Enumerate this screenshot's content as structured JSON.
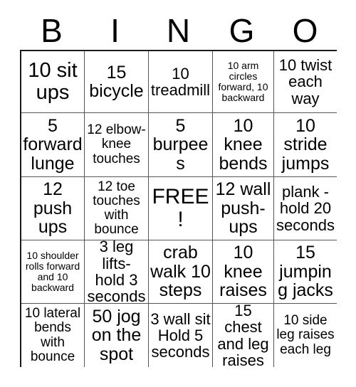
{
  "card": {
    "title": "BINGO",
    "header_letters": [
      "B",
      "I",
      "N",
      "G",
      "O"
    ],
    "free_space_label": "FREE!",
    "rows": 5,
    "columns": 5,
    "colors": {
      "background": "#ffffff",
      "text": "#000000",
      "grid_line": "#555555",
      "outer_border": "#1a1a1a"
    },
    "cells": [
      {
        "text": "10 sit ups",
        "size": "s-xl",
        "free": false
      },
      {
        "text": "15 bicycle",
        "size": "s-lg",
        "free": false
      },
      {
        "text": "10 treadmill",
        "size": "s-md",
        "free": false
      },
      {
        "text": "10 arm circles forward, 10 backward",
        "size": "s-xs",
        "free": false
      },
      {
        "text": "10 twist each way",
        "size": "s-md",
        "free": false
      },
      {
        "text": "5 forward lunge",
        "size": "s-lg",
        "free": false
      },
      {
        "text": "12 elbow-knee touches",
        "size": "s-sm",
        "free": false
      },
      {
        "text": "5 burpees",
        "size": "s-lg",
        "free": false
      },
      {
        "text": "10 knee bends",
        "size": "s-lg",
        "free": false
      },
      {
        "text": "10 stride jumps",
        "size": "s-lg",
        "free": false
      },
      {
        "text": "12 push ups",
        "size": "s-lg",
        "free": false
      },
      {
        "text": "12 toe touches with bounce",
        "size": "s-sm",
        "free": false
      },
      {
        "text": "FREE!",
        "size": "s-free",
        "free": true
      },
      {
        "text": "12 wall push-ups",
        "size": "s-lg",
        "free": false
      },
      {
        "text": "plank - hold 20 seconds",
        "size": "s-md",
        "free": false
      },
      {
        "text": "10 shoulder rolls forward and 10 backward",
        "size": "s-xs",
        "free": false
      },
      {
        "text": "3 leg lifts- hold 3 seconds",
        "size": "s-md",
        "free": false
      },
      {
        "text": "crab walk 10 steps",
        "size": "s-lg",
        "free": false
      },
      {
        "text": "10 knee raises",
        "size": "s-lg",
        "free": false
      },
      {
        "text": "15 jumping jacks",
        "size": "s-lg",
        "free": false
      },
      {
        "text": "10 lateral bends with bounce",
        "size": "s-sm",
        "free": false
      },
      {
        "text": "50 jog on the spot",
        "size": "s-lg",
        "free": false
      },
      {
        "text": "3 wall sit Hold 5 seconds",
        "size": "s-md",
        "free": false
      },
      {
        "text": "15 chest and leg raises",
        "size": "s-md",
        "free": false
      },
      {
        "text": "10 side leg raises each leg",
        "size": "s-sm",
        "free": false
      }
    ]
  }
}
